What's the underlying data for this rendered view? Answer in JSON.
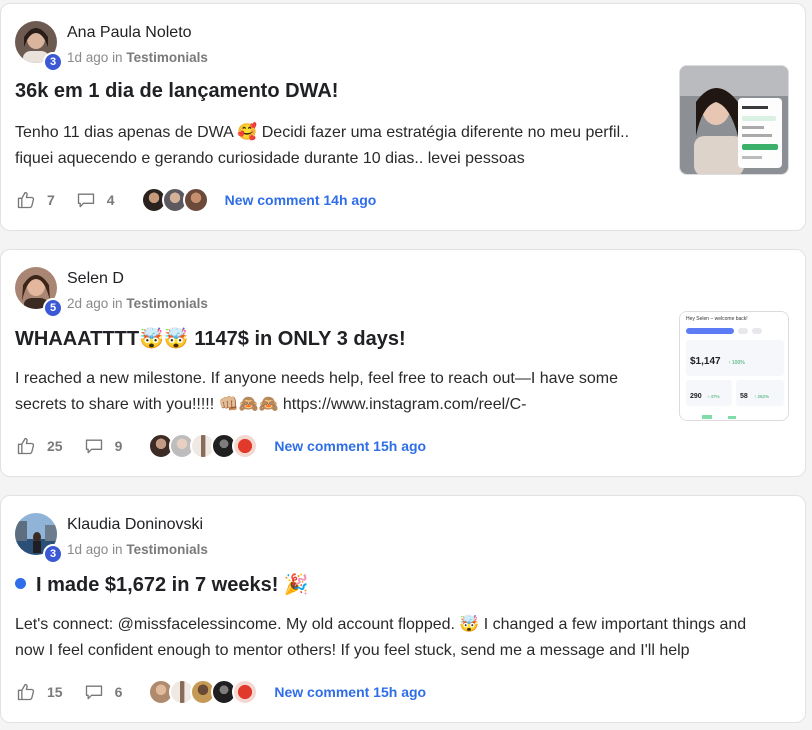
{
  "posts": [
    {
      "author": "Ana Paula Noleto",
      "level": "3",
      "time": "1d ago",
      "in_word": "in",
      "category": "Testimonials",
      "title": "36k em 1 dia de lançamento DWA!",
      "body": "Tenho 11 dias apenas de DWA 🥰 Decidi fazer uma estratégia diferente no meu perfil.. fiquei aquecendo e gerando curiosidade durante 10 dias.. levei pessoas",
      "likes": "7",
      "comments": "4",
      "new_comment": "New comment 14h ago",
      "has_thumbnail": true,
      "unread": false
    },
    {
      "author": "Selen D",
      "level": "5",
      "time": "2d ago",
      "in_word": "in",
      "category": "Testimonials",
      "title": "WHAAATTTT🤯🤯 1147$ in ONLY 3 days!",
      "body": "I reached a new milestone. If anyone needs help, feel free to reach out—I have some secrets to share with you!!!!! 👊🏼🙈🙈 https://www.instagram.com/reel/C-",
      "likes": "25",
      "comments": "9",
      "new_comment": "New comment 15h ago",
      "has_thumbnail": true,
      "thumbnail": {
        "greeting": "Hey Selen – welcome back!",
        "amount": "$1,147",
        "delta1": "↑ 100%",
        "metric_a": "290",
        "metric_a_delta": "↑ 47%",
        "metric_b": "58",
        "metric_b_delta": "↑ 262%"
      },
      "unread": false
    },
    {
      "author": "Klaudia Doninovski",
      "level": "3",
      "time": "1d ago",
      "in_word": "in",
      "category": "Testimonials",
      "title": "I made $1,672 in 7 weeks! 🎉",
      "body": "Let's connect: @missfacelessincome. My old account flopped. 🤯 I changed a few important things and now I feel confident enough to mentor others! If you feel stuck, send me a message and I'll help",
      "likes": "15",
      "comments": "6",
      "new_comment": "New comment 15h ago",
      "has_thumbnail": false,
      "unread": true
    }
  ],
  "icons": {
    "like": "thumbs-up-icon",
    "comment": "speech-bubble-icon"
  },
  "colors": {
    "accent": "#2f6ee8",
    "level_badge": "#3b59d4",
    "card_bg": "#ffffff",
    "page_bg": "#f4f4f5"
  }
}
